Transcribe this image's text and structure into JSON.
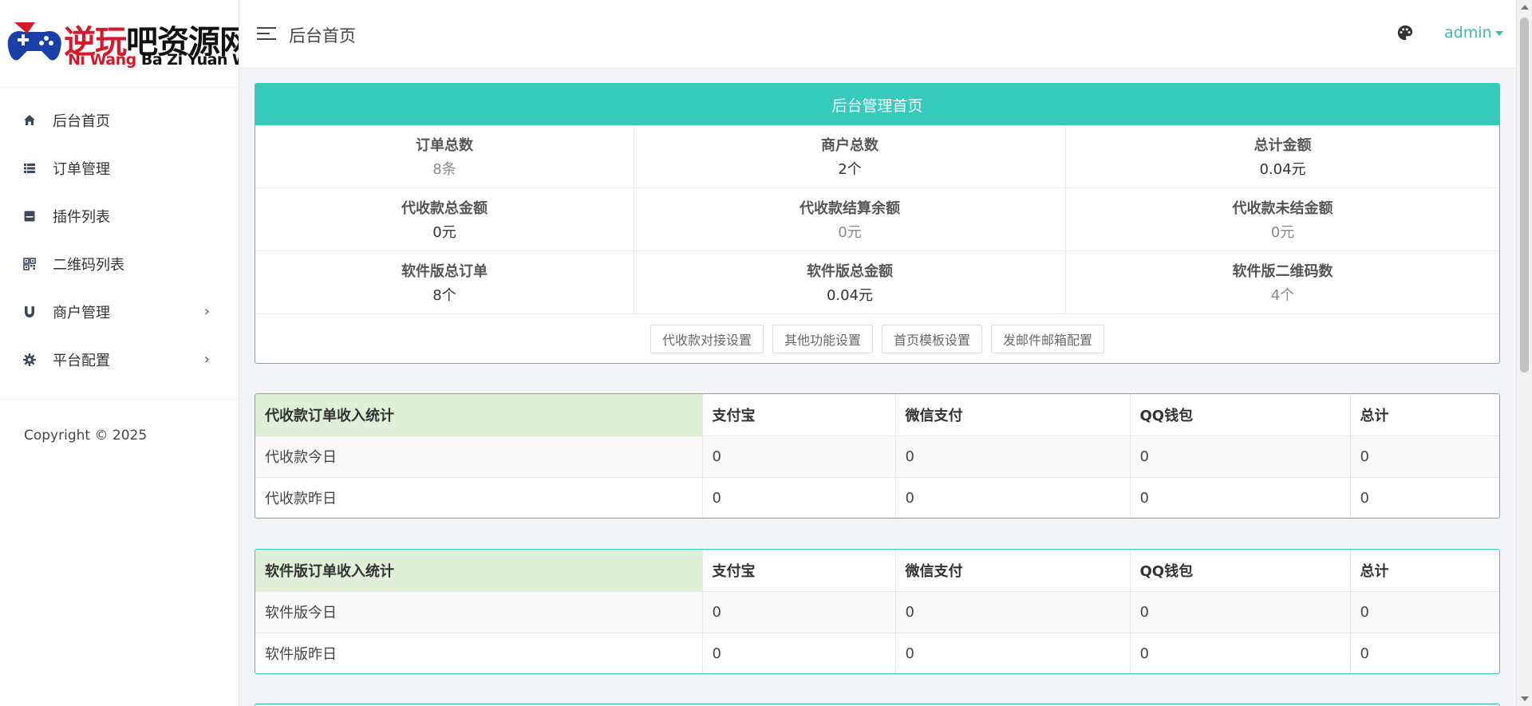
{
  "logo": {
    "cn_red": "逆玩",
    "cn_dark": "吧资源网",
    "en_part1": "Ni Wang ",
    "en_part2": "Ba Zi Yuan Wang"
  },
  "sidebar": {
    "items": [
      {
        "label": "后台首页",
        "icon": "home-icon",
        "has_children": false
      },
      {
        "label": "订单管理",
        "icon": "list-icon",
        "has_children": false
      },
      {
        "label": "插件列表",
        "icon": "plugin-icon",
        "has_children": false
      },
      {
        "label": "二维码列表",
        "icon": "qrcode-icon",
        "has_children": false
      },
      {
        "label": "商户管理",
        "icon": "magnet-icon",
        "has_children": true
      },
      {
        "label": "平台配置",
        "icon": "gear-icon",
        "has_children": true
      }
    ],
    "chevron": "›",
    "copyright": "Copyright © 2025"
  },
  "header": {
    "title": "后台首页",
    "user": "admin"
  },
  "dashboard": {
    "title": "后台管理首页",
    "stats": [
      {
        "label": "订单总数",
        "value": "8条",
        "muted": true
      },
      {
        "label": "商户总数",
        "value": "2个",
        "muted": false
      },
      {
        "label": "总计金额",
        "value": "0.04元",
        "muted": false
      },
      {
        "label": "代收款总金额",
        "value": "0元",
        "muted": false
      },
      {
        "label": "代收款结算余额",
        "value": "0元",
        "muted": true
      },
      {
        "label": "代收款未结金额",
        "value": "0元",
        "muted": true
      },
      {
        "label": "软件版总订单",
        "value": "8个",
        "muted": false
      },
      {
        "label": "软件版总金额",
        "value": "0.04元",
        "muted": false
      },
      {
        "label": "软件版二维码数",
        "value": "4个",
        "muted": true
      }
    ],
    "buttons": [
      "代收款对接设置",
      "其他功能设置",
      "首页模板设置",
      "发邮件邮箱配置"
    ]
  },
  "tables": [
    {
      "headers": [
        "代收款订单收入统计",
        "支付宝",
        "微信支付",
        "QQ钱包",
        "总计"
      ],
      "rows": [
        [
          "代收款今日",
          "0",
          "0",
          "0",
          "0"
        ],
        [
          "代收款昨日",
          "0",
          "0",
          "0",
          "0"
        ]
      ]
    },
    {
      "headers": [
        "软件版订单收入统计",
        "支付宝",
        "微信支付",
        "QQ钱包",
        "总计"
      ],
      "rows": [
        [
          "软件版今日",
          "0",
          "0",
          "0",
          "0"
        ],
        [
          "软件版昨日",
          "0",
          "0",
          "0",
          "0"
        ]
      ]
    }
  ],
  "colors": {
    "accent": "#35cabc",
    "panel_border": "#30cbb7",
    "table_head_first": "#dff0d8",
    "logo_red": "#d6182b",
    "user_link": "#3cb9a8"
  }
}
